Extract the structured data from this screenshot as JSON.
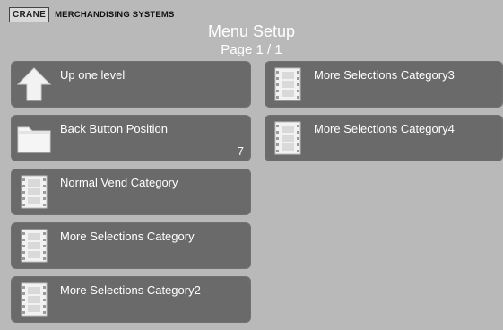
{
  "brand": {
    "logo": "CRANE",
    "name": "MERCHANDISING SYSTEMS"
  },
  "header": {
    "title": "Menu Setup",
    "page": "Page 1 / 1"
  },
  "left_tiles": [
    {
      "label": "Up one level",
      "icon": "up-arrow-icon",
      "value": ""
    },
    {
      "label": "Back Button Position",
      "icon": "folder-icon",
      "value": "7"
    },
    {
      "label": "Normal Vend Category",
      "icon": "film-strip-icon",
      "value": ""
    },
    {
      "label": "More Selections Category",
      "icon": "film-strip-icon",
      "value": ""
    },
    {
      "label": "More Selections Category2",
      "icon": "film-strip-icon",
      "value": ""
    }
  ],
  "right_tiles": [
    {
      "label": "More Selections Category3",
      "icon": "film-strip-icon",
      "value": ""
    },
    {
      "label": "More Selections Category4",
      "icon": "film-strip-icon",
      "value": ""
    }
  ]
}
